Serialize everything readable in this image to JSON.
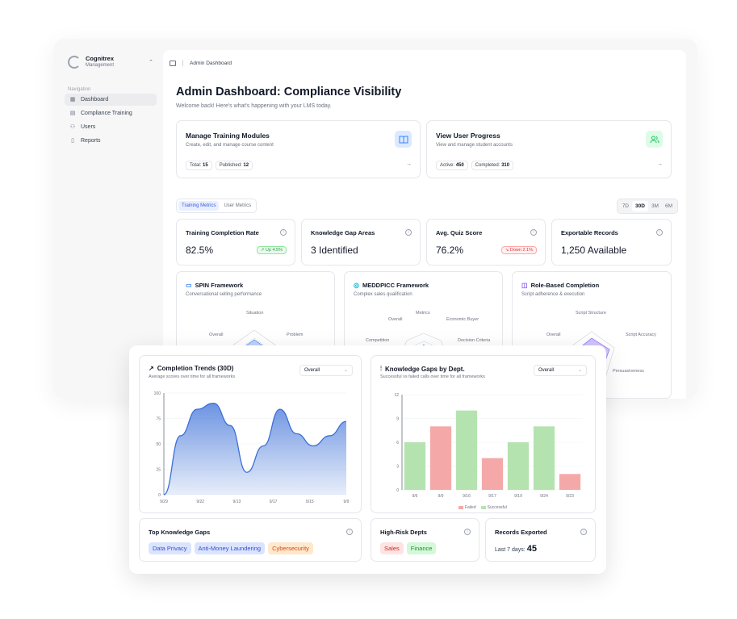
{
  "sidebar": {
    "brand_name": "Cognitrex",
    "brand_sub": "Management",
    "nav_caption": "Navigation",
    "items": [
      {
        "label": "Dashboard",
        "icon": "grid-icon"
      },
      {
        "label": "Compliance Training",
        "icon": "list-icon"
      },
      {
        "label": "Users",
        "icon": "users-icon"
      },
      {
        "label": "Reports",
        "icon": "file-icon"
      }
    ]
  },
  "topbar": {
    "breadcrumb": "Admin Dashboard"
  },
  "header": {
    "title": "Admin Dashboard: Compliance Visibility",
    "subtitle": "Welcome back! Here's what's happening with your LMS today."
  },
  "modules": [
    {
      "title": "Manage Training Modules",
      "subtitle": "Create, edit, and manage course content",
      "pill1_label": "Total:",
      "pill1_value": "15",
      "pill2_label": "Published:",
      "pill2_value": "12",
      "icon": "book-icon",
      "icon_color": "#3b82f6",
      "icon_bg": "#dbeafe"
    },
    {
      "title": "View User Progress",
      "subtitle": "View and manage student accounts",
      "pill1_label": "Active:",
      "pill1_value": "450",
      "pill2_label": "Completed:",
      "pill2_value": "310",
      "icon": "users-icon",
      "icon_color": "#22c55e",
      "icon_bg": "#dcfce7"
    }
  ],
  "tabs": [
    "Training Metrics",
    "User Metrics"
  ],
  "ranges": [
    "7D",
    "30D",
    "3M",
    "6M"
  ],
  "metrics": [
    {
      "title": "Training Completion Rate",
      "value": "82.5%",
      "delta": "Up 4.5%",
      "dir": "up"
    },
    {
      "title": "Knowledge Gap Areas",
      "value": "3 Identified",
      "delta": "",
      "dir": ""
    },
    {
      "title": "Avg. Quiz Score",
      "value": "76.2%",
      "delta": "Down 2.1%",
      "dir": "down"
    },
    {
      "title": "Exportable Records",
      "value": "1,250 Available",
      "delta": "",
      "dir": ""
    }
  ],
  "frameworks": [
    {
      "title": "SPIN Framework",
      "subtitle": "Conversational selling performance",
      "labels": [
        "Situation",
        "Problem",
        "Overall"
      ],
      "color": "#3b82f6"
    },
    {
      "title": "MEDDPICC Framework",
      "subtitle": "Complex sales qualification",
      "labels": [
        "Metrics",
        "Economic Buyer",
        "Decision Criteria",
        "Competition",
        "Overall"
      ],
      "color": "#06b6d4"
    },
    {
      "title": "Role-Based Completion",
      "subtitle": "Script adherence & execution",
      "labels": [
        "Script Structure",
        "Script Accuracy",
        "Persuasiveness",
        "Overall"
      ],
      "color": "#8b5cf6"
    }
  ],
  "charts_meta": {
    "trend_title": "Completion Trends (30D)",
    "trend_sub": "Average scores over time for all frameworks",
    "trend_select": "Overall",
    "gaps_title": "Knowledge Gaps by Dept.",
    "gaps_sub": "Successful vs failed calls over time for all frameworks",
    "gaps_select": "Overall"
  },
  "chart_data": [
    {
      "type": "area",
      "title": "Completion Trends (30D)",
      "x": [
        "9/29",
        "9/22",
        "9/13",
        "9/17",
        "9/15",
        "9/9"
      ],
      "y_ticks": [
        0,
        25,
        50,
        75,
        100
      ],
      "ylim": [
        0,
        100
      ],
      "series": [
        {
          "values": [
            0,
            58,
            84,
            90,
            68,
            22,
            48,
            84,
            60,
            48,
            58,
            72
          ]
        }
      ],
      "color": "#3b6fd8"
    },
    {
      "type": "bar",
      "title": "Knowledge Gaps by Dept.",
      "categories": [
        "9/6",
        "9/9",
        "9/16",
        "9/17",
        "9/19",
        "9/24",
        "9/23"
      ],
      "y_ticks": [
        0,
        3,
        6,
        9,
        12
      ],
      "ylim": [
        0,
        12
      ],
      "values": [
        6,
        8,
        10,
        4,
        6,
        8,
        2
      ],
      "status": [
        "Successful",
        "Failed",
        "Successful",
        "Failed",
        "Successful",
        "Successful",
        "Failed"
      ],
      "legend": [
        "Failed",
        "Successful"
      ],
      "colors": {
        "Failed": "#f4a9a8",
        "Successful": "#b5e3b0"
      }
    }
  ],
  "bottom": {
    "gaps_title": "Top Knowledge Gaps",
    "gaps_tags": [
      "Data Privacy",
      "Anti-Money Laundering",
      "Cybersecurity"
    ],
    "risk_title": "High-Risk Depts",
    "risk_tags": [
      "Sales",
      "Finance"
    ],
    "records_title": "Records Exported",
    "records_label": "Last 7 days:",
    "records_value": "45"
  }
}
